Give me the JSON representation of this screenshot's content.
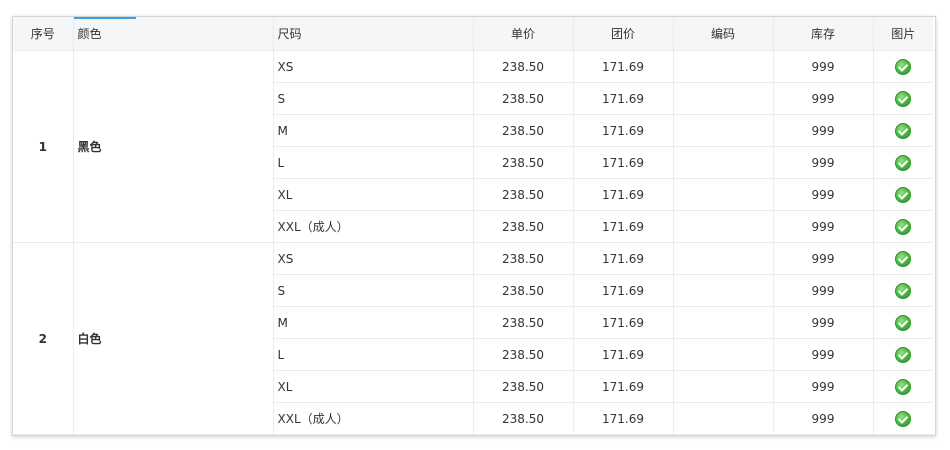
{
  "columns": {
    "index": "序号",
    "color": "颜色",
    "size": "尺码",
    "unit_price": "单价",
    "group_price": "团价",
    "code": "编码",
    "stock": "库存",
    "image": "图片"
  },
  "groups": [
    {
      "index": "1",
      "color": "黑色",
      "rows": [
        {
          "size": "XS",
          "unit_price": "238.50",
          "group_price": "171.69",
          "code": "",
          "stock": "999"
        },
        {
          "size": "S",
          "unit_price": "238.50",
          "group_price": "171.69",
          "code": "",
          "stock": "999"
        },
        {
          "size": "M",
          "unit_price": "238.50",
          "group_price": "171.69",
          "code": "",
          "stock": "999"
        },
        {
          "size": "L",
          "unit_price": "238.50",
          "group_price": "171.69",
          "code": "",
          "stock": "999"
        },
        {
          "size": "XL",
          "unit_price": "238.50",
          "group_price": "171.69",
          "code": "",
          "stock": "999"
        },
        {
          "size": "XXL（成人）",
          "unit_price": "238.50",
          "group_price": "171.69",
          "code": "",
          "stock": "999"
        }
      ]
    },
    {
      "index": "2",
      "color": "白色",
      "rows": [
        {
          "size": "XS",
          "unit_price": "238.50",
          "group_price": "171.69",
          "code": "",
          "stock": "999"
        },
        {
          "size": "S",
          "unit_price": "238.50",
          "group_price": "171.69",
          "code": "",
          "stock": "999"
        },
        {
          "size": "M",
          "unit_price": "238.50",
          "group_price": "171.69",
          "code": "",
          "stock": "999"
        },
        {
          "size": "L",
          "unit_price": "238.50",
          "group_price": "171.69",
          "code": "",
          "stock": "999"
        },
        {
          "size": "XL",
          "unit_price": "238.50",
          "group_price": "171.69",
          "code": "",
          "stock": "999"
        },
        {
          "size": "XXL（成人）",
          "unit_price": "238.50",
          "group_price": "171.69",
          "code": "",
          "stock": "999"
        }
      ]
    }
  ],
  "image_icon": "check-circle-icon",
  "colors": {
    "accent": "#3a9ee6",
    "header_bg": "#f5f6f8",
    "check_green": "#46b53f"
  }
}
